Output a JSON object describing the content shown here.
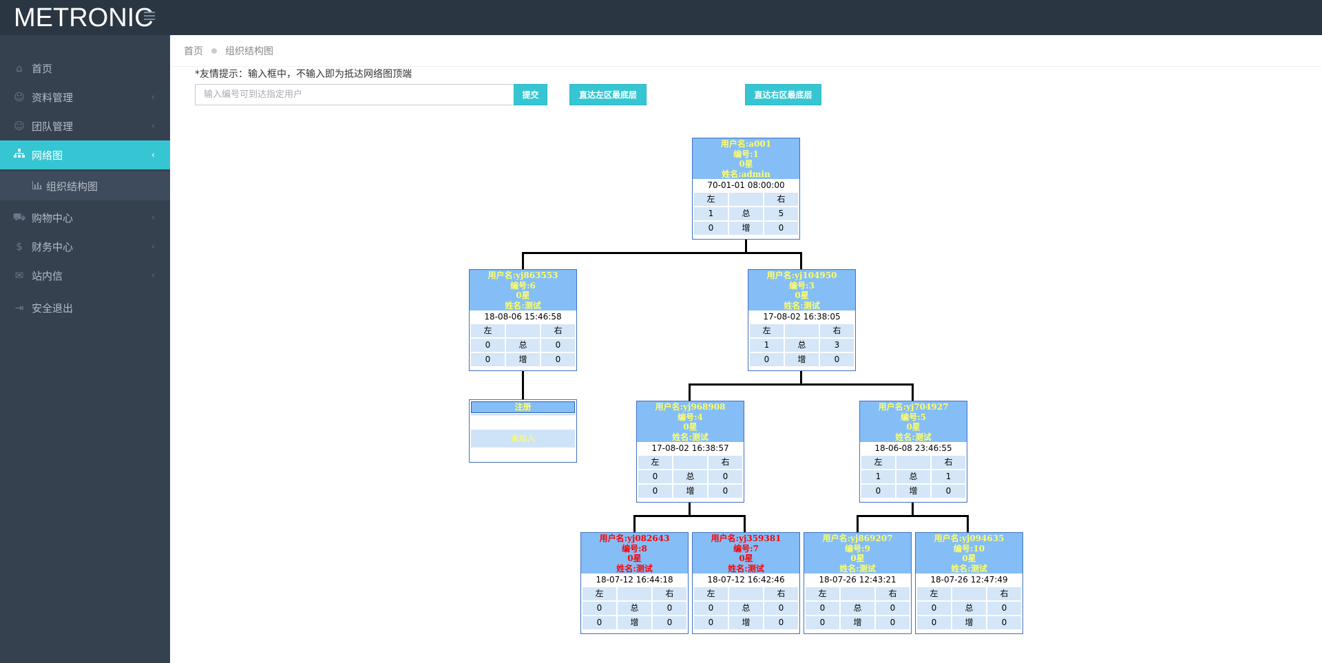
{
  "brand": "METRONIC",
  "sidebar": {
    "items": [
      {
        "label": "首页",
        "icon": "home-icon"
      },
      {
        "label": "资料管理",
        "icon": "user-icon"
      },
      {
        "label": "团队管理",
        "icon": "user-outline-icon"
      },
      {
        "label": "网络图",
        "icon": "sitemap-icon"
      },
      {
        "label": "组织结构图",
        "icon": "bar-chart-icon"
      },
      {
        "label": "购物中心",
        "icon": "truck-icon"
      },
      {
        "label": "财务中心",
        "icon": "dollar-icon"
      },
      {
        "label": "站内信",
        "icon": "envelope-icon"
      },
      {
        "label": "安全退出",
        "icon": "logout-icon"
      }
    ]
  },
  "breadcrumb": {
    "home": "首页",
    "current": "组织结构图"
  },
  "tip": "*友情提示：输入框中，不输入即为抵达网络图顶端",
  "search": {
    "placeholder": "输入编号可到达指定用户",
    "value": ""
  },
  "buttons": {
    "submit": "提交",
    "left_bottom": "直达左区最底层",
    "right_bottom": "直达右区最底层"
  },
  "table_labels": {
    "left": "左",
    "right": "右",
    "total": "总",
    "increase": "增"
  },
  "nodes": [
    {
      "username": "用户名:a001",
      "id": "编号:1",
      "star": "0星",
      "name": "姓名:admin",
      "date": "70-01-01 08:00:00",
      "total_left": "1",
      "total_right": "5",
      "inc_left": "0",
      "inc_right": "0"
    },
    {
      "username": "用户名:yj863553",
      "id": "编号:6",
      "star": "0星",
      "name": "姓名:测试",
      "date": "18-08-06 15:46:58",
      "total_left": "0",
      "total_right": "0",
      "inc_left": "0",
      "inc_right": "0"
    },
    {
      "username": "用户名:yj104950",
      "id": "编号:3",
      "star": "0星",
      "name": "姓名:测试",
      "date": "17-08-02 16:38:05",
      "total_left": "1",
      "total_right": "3",
      "inc_left": "0",
      "inc_right": "0"
    },
    {
      "username": "用户名:yj968908",
      "id": "编号:4",
      "star": "0星",
      "name": "姓名:测试",
      "date": "17-08-02 16:38:57",
      "total_left": "0",
      "total_right": "0",
      "inc_left": "0",
      "inc_right": "0"
    },
    {
      "username": "用户名:yj704927",
      "id": "编号:5",
      "star": "0星",
      "name": "姓名:测试",
      "date": "18-06-08 23:46:55",
      "total_left": "1",
      "total_right": "1",
      "inc_left": "0",
      "inc_right": "0"
    },
    {
      "username": "用户名:yj082643",
      "id": "编号:8",
      "star": "0星",
      "name": "姓名:测试",
      "date": "18-07-12 16:44:18",
      "total_left": "0",
      "total_right": "0",
      "inc_left": "0",
      "inc_right": "0"
    },
    {
      "username": "用户名:yj359381",
      "id": "编号:7",
      "star": "0星",
      "name": "姓名:测试",
      "date": "18-07-12 16:42:46",
      "total_left": "0",
      "total_right": "0",
      "inc_left": "0",
      "inc_right": "0"
    },
    {
      "username": "用户名:yj869207",
      "id": "编号:9",
      "star": "0星",
      "name": "姓名:测试",
      "date": "18-07-26 12:43:21",
      "total_left": "0",
      "total_right": "0",
      "inc_left": "0",
      "inc_right": "0"
    },
    {
      "username": "用户名:yj094635",
      "id": "编号:10",
      "star": "0星",
      "name": "姓名:测试",
      "date": "18-07-26 12:47:49",
      "total_left": "0",
      "total_right": "0",
      "inc_left": "0",
      "inc_right": "0"
    }
  ],
  "register": {
    "title": "注册",
    "status": "未加入"
  },
  "colors": {
    "topbar": "#2b3643",
    "sidebar": "#364150",
    "accent": "#36c6d3",
    "node_head": "#85bdf6",
    "node_cell": "#d4e6f7",
    "text_yellow": "#ffff66",
    "text_red": "#ff0000"
  }
}
